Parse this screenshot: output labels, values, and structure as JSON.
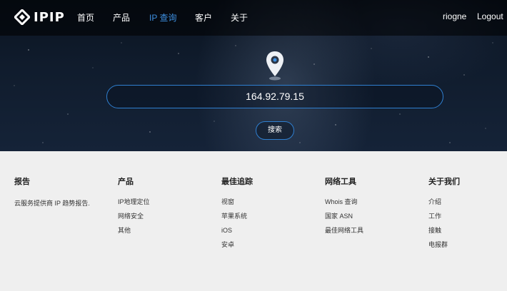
{
  "brand": {
    "name": "IPIP"
  },
  "nav": {
    "items": [
      {
        "label": "首页",
        "active": false
      },
      {
        "label": "产品",
        "active": false
      },
      {
        "label": "IP 查询",
        "active": true
      },
      {
        "label": "客户",
        "active": false
      },
      {
        "label": "关于",
        "active": false
      }
    ],
    "user": "riogne",
    "logout": "Logout"
  },
  "search": {
    "value": "164.92.79.15",
    "button_label": "搜索",
    "icon": "location-pin-icon"
  },
  "footer": {
    "report": {
      "title": "报告",
      "text": "云服务提供商 IP 趋势报告."
    },
    "products": {
      "title": "产品",
      "links": [
        "IP地理定位",
        "网络安全",
        "其他"
      ]
    },
    "tracking": {
      "title": "最佳追踪",
      "links": [
        "视窗",
        "苹果系统",
        "iOS",
        "安卓"
      ]
    },
    "tools": {
      "title": "网络工具",
      "links": [
        "Whois 查询",
        "国家 ASN",
        "最佳网络工具"
      ]
    },
    "about": {
      "title": "关于我们",
      "links": [
        "介绍",
        "工作",
        "接触",
        "电报群"
      ]
    }
  },
  "colors": {
    "accent": "#3d8fe0",
    "border": "#2f7fd0",
    "footer_bg": "#efefef",
    "navbar_bg": "#0a0f18"
  }
}
